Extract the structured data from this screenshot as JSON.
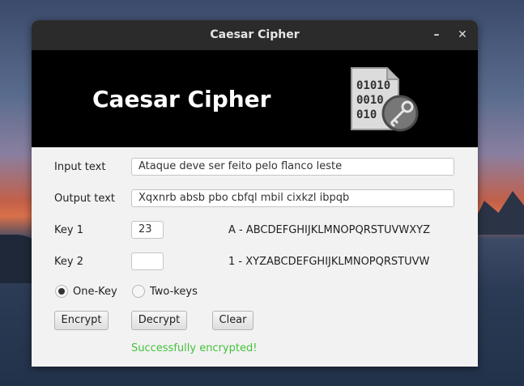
{
  "window": {
    "title": "Caesar Cipher",
    "minimize_glyph": "–",
    "close_glyph": "✕"
  },
  "banner": {
    "title": "Caesar Cipher",
    "logo_icon": "binary-file-key-icon",
    "logo_digits": [
      "01010",
      "0010",
      "010"
    ]
  },
  "form": {
    "input_label": "Input text",
    "input_value": "Ataque deve ser feito pelo flanco leste",
    "output_label": "Output text",
    "output_value": "Xqxnrb absb pbo cbfql mbil cixkzl ibpqb",
    "key1_label": "Key 1",
    "key1_value": "23",
    "key1_alphabet": "A - ABCDEFGHIJKLMNOPQRSTUVWXYZ",
    "key2_label": "Key 2",
    "key2_value": "",
    "key2_alphabet": "1 - XYZABCDEFGHIJKLMNOPQRSTUVW",
    "radio_one": "One-Key",
    "radio_two": "Two-keys",
    "selected_mode": "One-Key"
  },
  "buttons": {
    "encrypt": "Encrypt",
    "decrypt": "Decrypt",
    "clear": "Clear"
  },
  "status": {
    "message": "Successfully encrypted!",
    "color": "#44c23a"
  }
}
